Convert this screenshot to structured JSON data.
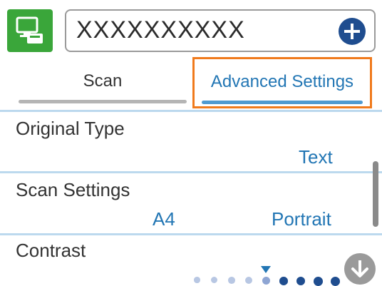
{
  "header": {
    "app_icon": "scan-to-computer-icon",
    "destination_value": "XXXXXXXXXX",
    "add_button_icon": "plus-icon"
  },
  "tabs": [
    {
      "label": "Scan",
      "selected": false
    },
    {
      "label": "Advanced Settings",
      "selected": true
    }
  ],
  "settings": {
    "original_type": {
      "label": "Original Type",
      "value": "Text"
    },
    "scan_settings": {
      "label": "Scan Settings",
      "size": "A4",
      "orientation": "Portrait"
    },
    "contrast": {
      "label": "Contrast",
      "level": 5,
      "levels": 9
    }
  },
  "controls": {
    "scroll_down_icon": "arrow-down-icon"
  },
  "colors": {
    "accent_blue": "#2276b4",
    "app_green": "#3aa63a",
    "focus_orange": "#f07a1c",
    "add_button": "#1f4d8f"
  }
}
